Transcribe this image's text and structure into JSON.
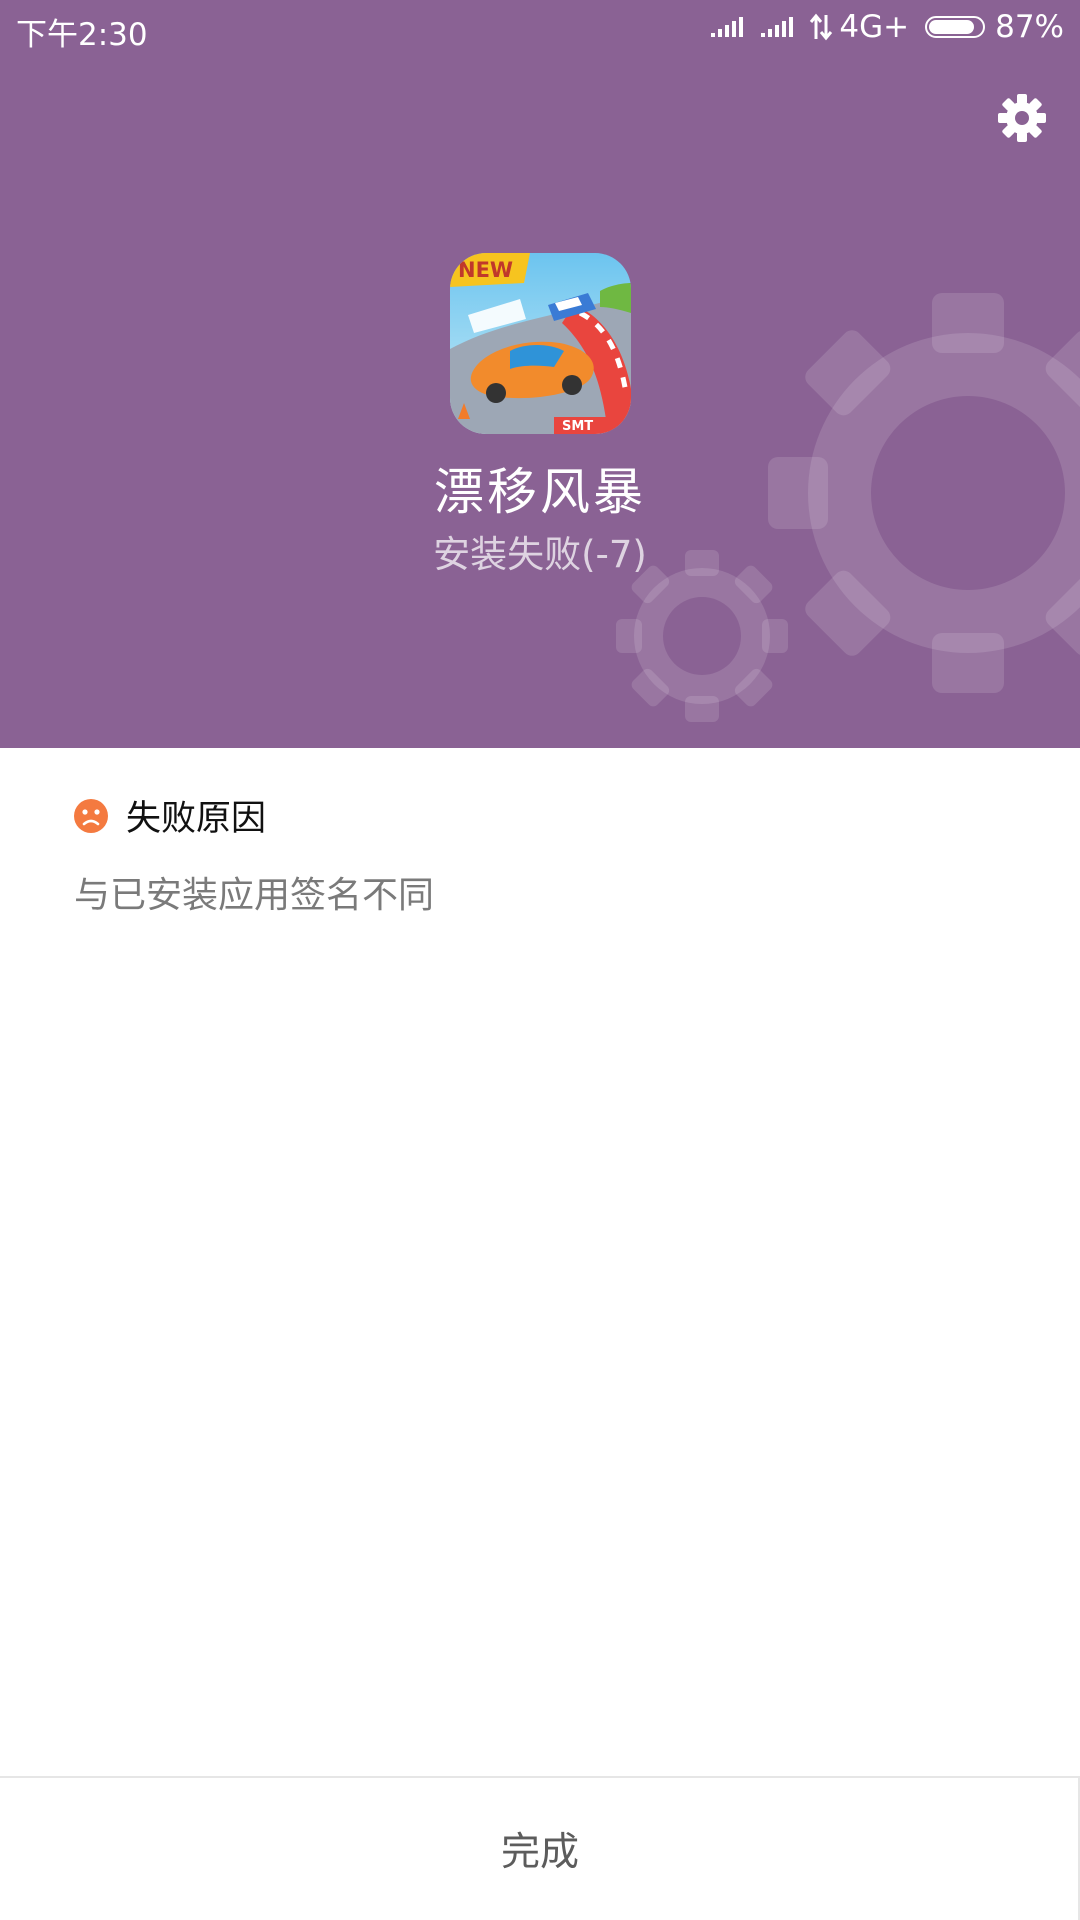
{
  "status_bar": {
    "time": "下午2:30",
    "network": "4G+",
    "battery": "87%",
    "battery_level": 0.87
  },
  "header": {
    "settings_icon": "gear-icon",
    "background_color": "#8a6294",
    "app_icon": "race-car-game-icon",
    "app_icon_badge": "NEW",
    "app_name": "漂移风暴",
    "install_status": "安装失败(-7)"
  },
  "failure": {
    "icon": "sad-face-icon",
    "icon_color": "#f47a40",
    "title": "失败原因",
    "message": "与已安装应用签名不同"
  },
  "footer": {
    "done_label": "完成"
  }
}
